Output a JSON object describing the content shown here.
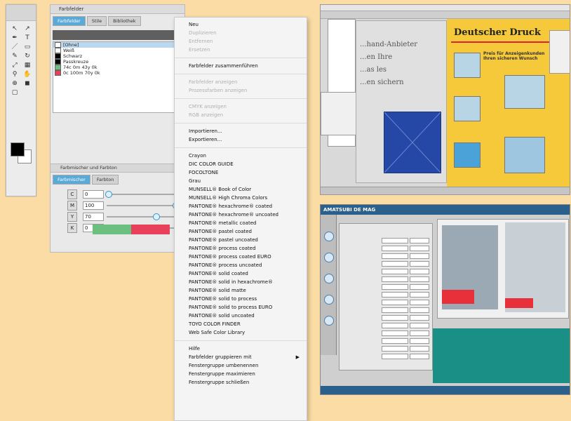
{
  "colors": {
    "background": "#fbdca5",
    "accent_blue": "#5aa9d6",
    "swatch_green": "#6cc07f",
    "swatch_red": "#e8405a",
    "layout_yellow": "#f6c93a",
    "layout_blue": "#2548a6",
    "teal": "#1a8f86"
  },
  "toolbox": {
    "icons": [
      "selection-tool-icon",
      "direct-selection-icon",
      "pen-icon",
      "text-icon",
      "line-icon",
      "rectangle-icon",
      "pencil-icon",
      "rotate-icon",
      "scale-icon",
      "gradient-icon",
      "eyedropper-icon",
      "hand-icon",
      "zoom-icon",
      "fill-stroke-icon",
      "screen-mode-icon"
    ]
  },
  "panel": {
    "title": "Farbfelder",
    "tabs": [
      "Farbfelder",
      "Stile",
      "Bibliothek"
    ],
    "swatches": [
      {
        "label": "[Ohne]",
        "color": "#ffffff"
      },
      {
        "label": "Weiß",
        "color": "#ffffff"
      },
      {
        "label": "Schwarz",
        "color": "#000000"
      },
      {
        "label": "Passkreuze",
        "color": "#000000"
      },
      {
        "label": "74c 0m 43y 0k",
        "color": "#6cc07f"
      },
      {
        "label": "0c 100m 70y 0k",
        "color": "#e8405a"
      }
    ],
    "section2_title": "Farbmischer und Farbton",
    "section2_tabs": [
      "Farbmischer",
      "Farbton"
    ],
    "sliders": [
      {
        "label": "C",
        "value": "0",
        "percent": 0.02
      },
      {
        "label": "M",
        "value": "100",
        "percent": 0.98
      },
      {
        "label": "Y",
        "value": "70",
        "percent": 0.7
      },
      {
        "label": "K",
        "value": "0",
        "percent": 0.02
      }
    ]
  },
  "menu": {
    "items": [
      {
        "label": "Neu",
        "disabled": false
      },
      {
        "label": "Duplizieren",
        "disabled": true
      },
      {
        "label": "Entfernen",
        "disabled": true
      },
      {
        "label": "Ersetzen",
        "disabled": true
      },
      {
        "sep": true
      },
      {
        "label": "Farbfelder zusammenführen",
        "disabled": false
      },
      {
        "sep": true
      },
      {
        "label": "Farbfelder anzeigen",
        "disabled": true
      },
      {
        "label": "Prozessfarben anzeigen",
        "disabled": true
      },
      {
        "sep": true
      },
      {
        "label": "CMYK anzeigen",
        "disabled": true
      },
      {
        "label": "RGB anzeigen",
        "disabled": true
      },
      {
        "sep": true
      },
      {
        "label": "Importieren...",
        "disabled": false
      },
      {
        "label": "Exportieren...",
        "disabled": false
      },
      {
        "sep": true
      },
      {
        "label": "Crayon",
        "disabled": false
      },
      {
        "label": "DIC COLOR GUIDE",
        "disabled": false
      },
      {
        "label": "FOCOLTONE",
        "disabled": false
      },
      {
        "label": "Grau",
        "disabled": false
      },
      {
        "label": "MUNSELL® Book of Color",
        "disabled": false
      },
      {
        "label": "MUNSELL® High Chroma Colors",
        "disabled": false
      },
      {
        "label": "PANTONE® hexachrome® coated",
        "disabled": false
      },
      {
        "label": "PANTONE® hexachrome® uncoated",
        "disabled": false
      },
      {
        "label": "PANTONE® metallic coated",
        "disabled": false
      },
      {
        "label": "PANTONE® pastel coated",
        "disabled": false
      },
      {
        "label": "PANTONE® pastel uncoated",
        "disabled": false
      },
      {
        "label": "PANTONE® process coated",
        "disabled": false
      },
      {
        "label": "PANTONE® process coated EURO",
        "disabled": false
      },
      {
        "label": "PANTONE® process uncoated",
        "disabled": false
      },
      {
        "label": "PANTONE® solid coated",
        "disabled": false
      },
      {
        "label": "PANTONE® solid in hexachrome®",
        "disabled": false
      },
      {
        "label": "PANTONE® solid matte",
        "disabled": false
      },
      {
        "label": "PANTONE® solid to process",
        "disabled": false
      },
      {
        "label": "PANTONE® solid to process EURO",
        "disabled": false
      },
      {
        "label": "PANTONE® solid uncoated",
        "disabled": false
      },
      {
        "label": "TOYO COLOR FINDER",
        "disabled": false
      },
      {
        "label": "Web Safe Color Library",
        "disabled": false
      },
      {
        "sep": true
      },
      {
        "label": "Hilfe",
        "disabled": false
      },
      {
        "label": "Farbfelder gruppieren mit",
        "disabled": false,
        "submenu": true
      },
      {
        "label": "Fenstergruppe umbenennen",
        "disabled": false
      },
      {
        "label": "Fenstergruppe maximieren",
        "disabled": false
      },
      {
        "label": "Fenstergruppe schließen",
        "disabled": false
      }
    ]
  },
  "layout_shot": {
    "headline": "Deutscher Druck",
    "left_text": "...hand-Anbieter\n...en Ihre\n...as les\n...en sichern",
    "right_snippet": "Preis für Anzeigenkunden\nIhren sicheren Wunsch",
    "submenu_arrow": "▶"
  },
  "app_shot": {
    "title": "AMATSUBI DE MAG"
  }
}
